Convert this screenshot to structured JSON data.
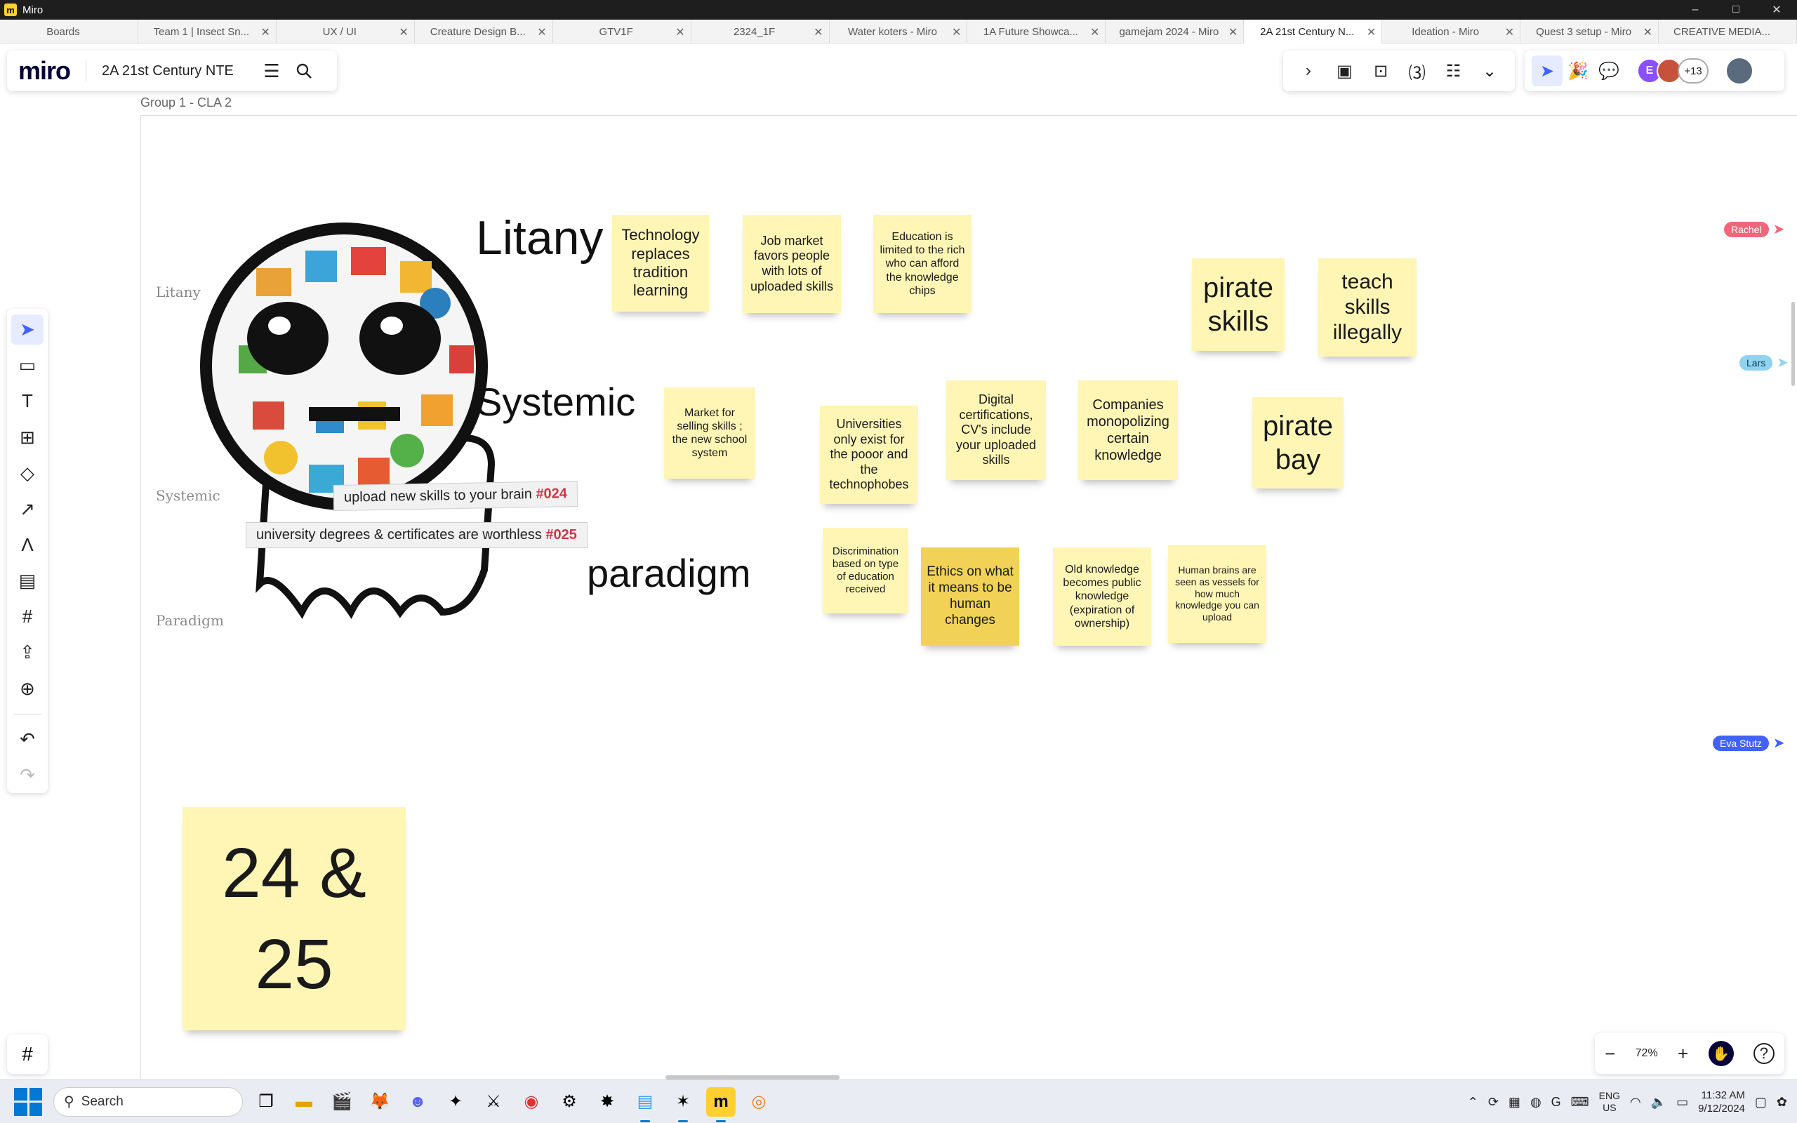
{
  "window": {
    "title": "Miro",
    "minimize": "–",
    "maximize": "□",
    "close": "✕"
  },
  "tabs": [
    {
      "label": "Boards"
    },
    {
      "label": "Team 1 | Insect Sn..."
    },
    {
      "label": "UX / UI"
    },
    {
      "label": "Creature Design B..."
    },
    {
      "label": "GTV1F"
    },
    {
      "label": "2324_1F"
    },
    {
      "label": "Water koters - Miro"
    },
    {
      "label": "1A Future Showca..."
    },
    {
      "label": "gamejam 2024 - Miro"
    },
    {
      "label": "2A 21st Century N..."
    },
    {
      "label": "Ideation - Miro"
    },
    {
      "label": "Quest 3 setup - Miro"
    },
    {
      "label": "CREATIVE MEDIA..."
    }
  ],
  "active_tab_index": 9,
  "header": {
    "logo": "miro",
    "board_name": "2A 21st Century NTE"
  },
  "frame": {
    "label": "Group 1 - CLA 2"
  },
  "collaborators": {
    "avatar_initial": "E",
    "more_count": "+13"
  },
  "layer_labels": {
    "litany": "Litany",
    "systemic": "Systemic",
    "paradigm": "Paradigm"
  },
  "headings": {
    "litany": "Litany",
    "systemic": "Systemic",
    "paradigm": "paradigm"
  },
  "meme": {
    "caption1_text": "upload new skills to your brain ",
    "caption1_tag": "#024",
    "caption2_text": "university degrees & certificates are worthless ",
    "caption2_tag": "#025"
  },
  "stickies": {
    "litany1": "Technology replaces tradition learning",
    "litany2": "Job market favors people with lots of uploaded skills",
    "litany3": "Education is limited to the rich who can afford the knowledge chips",
    "pirate_skills": "pirate skills",
    "teach_illegally": "teach skills illegally",
    "systemic1": "Market for selling skills ; the new school system",
    "systemic2": "Universities only exist for the pooor and the technophobes",
    "systemic3": "Digital certifications, CV's include your uploaded skills",
    "systemic4": "Companies monopolizing certain knowledge",
    "pirate_bay": "pirate bay",
    "paradigm1": "Discrimination based on type of education received",
    "paradigm2": "Ethics on what it means to be human changes",
    "paradigm3": "Old knowledge becomes public knowledge (expiration of ownership)",
    "paradigm4": "Human brains are seen as vessels for how much knowledge you can upload",
    "big_number": "24 & 25"
  },
  "cursors": {
    "rachel": {
      "name": "Rachel",
      "color": "#f0677b"
    },
    "lars": {
      "name": "Lars",
      "color": "#8fd3f0"
    },
    "eva": {
      "name": "Eva Stutz",
      "color": "#4262ff"
    }
  },
  "zoom": {
    "minus": "−",
    "value": "72%",
    "plus": "+",
    "help": "?"
  },
  "taskbar": {
    "search_placeholder": "Search",
    "lang_line1": "ENG",
    "lang_line2": "US",
    "time": "11:32 AM",
    "date": "9/12/2024"
  },
  "colors": {
    "sticky_yellow": "#fff6b6",
    "sticky_dark_yellow": "#f1d257",
    "miro_blue": "#4262ff",
    "meme_tag_red": "#d23547"
  }
}
